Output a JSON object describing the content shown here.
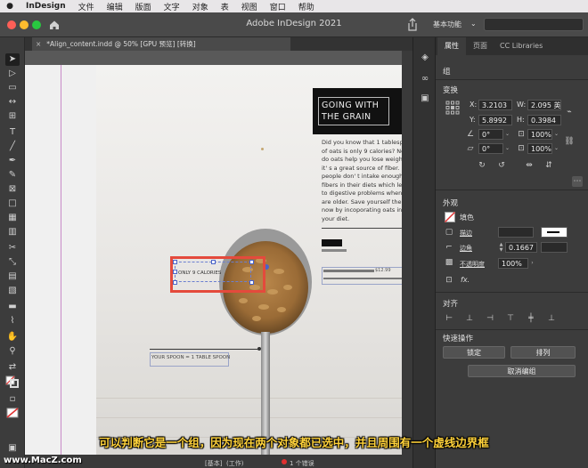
{
  "menubar": {
    "app": "InDesign",
    "items": [
      "文件",
      "编辑",
      "版面",
      "文字",
      "对象",
      "表",
      "视图",
      "窗口",
      "帮助"
    ]
  },
  "window": {
    "title": "Adobe InDesign 2021",
    "workspace": "基本功能",
    "workspace_chevron": "⌄"
  },
  "document_tab": {
    "close": "×",
    "label": "*Align_content.indd @ 50% [GPU 预览] [转换]"
  },
  "layout": {
    "title_line1": "GOING WITH",
    "title_line2": "THE GRAIN",
    "body_text": "Did you know that 1 tablespoon\nof oats is only 9 calories? Not on\ndo oats help you lose weight b\nit' s a great source of fiber. Mo\npeople don' t intake enough\nfibers in their diets which leads\nto digestive problems when the\nare older. Save yourself the tim\nnow by incoporating oats into\nyour diet.",
    "price": "$12.99",
    "selected_label": "ONLY 9 CALORIES",
    "spoon_caption": "YOUR SPOON = 1 TABLE SPOON"
  },
  "status": {
    "style": "[基本]",
    "style_sub": "(工作)",
    "errors": "1 个错误"
  },
  "panel": {
    "tabs": [
      "属性",
      "页面",
      "CC Libraries"
    ],
    "object_type": "组",
    "transform": {
      "heading": "变换",
      "x_label": "X:",
      "x_value": "3.2103",
      "w_label": "W:",
      "w_value": "2.095 英",
      "y_label": "Y:",
      "y_value": "5.8992",
      "h_label": "H:",
      "h_value": "0.3984",
      "rotate_value": "0°",
      "scale_x_value": "100%",
      "shear_value": "0°",
      "scale_y_value": "100%"
    },
    "appearance": {
      "heading": "外观",
      "fill_label": "填色",
      "stroke_label": "描边",
      "corner_label": "边角",
      "corner_value": "0.1667",
      "opacity_label": "不透明度",
      "opacity_value": "100%",
      "fx_label": "fx."
    },
    "align": {
      "heading": "对齐"
    },
    "quick_actions": {
      "heading": "快速操作",
      "lock": "锁定",
      "arrange": "排列",
      "ungroup": "取消编组"
    }
  },
  "subtitle": "可以判断它是一个组，因为现在两个对象都已选中，并且周围有一个虚线边界框",
  "watermark": "www.MacZ.com"
}
